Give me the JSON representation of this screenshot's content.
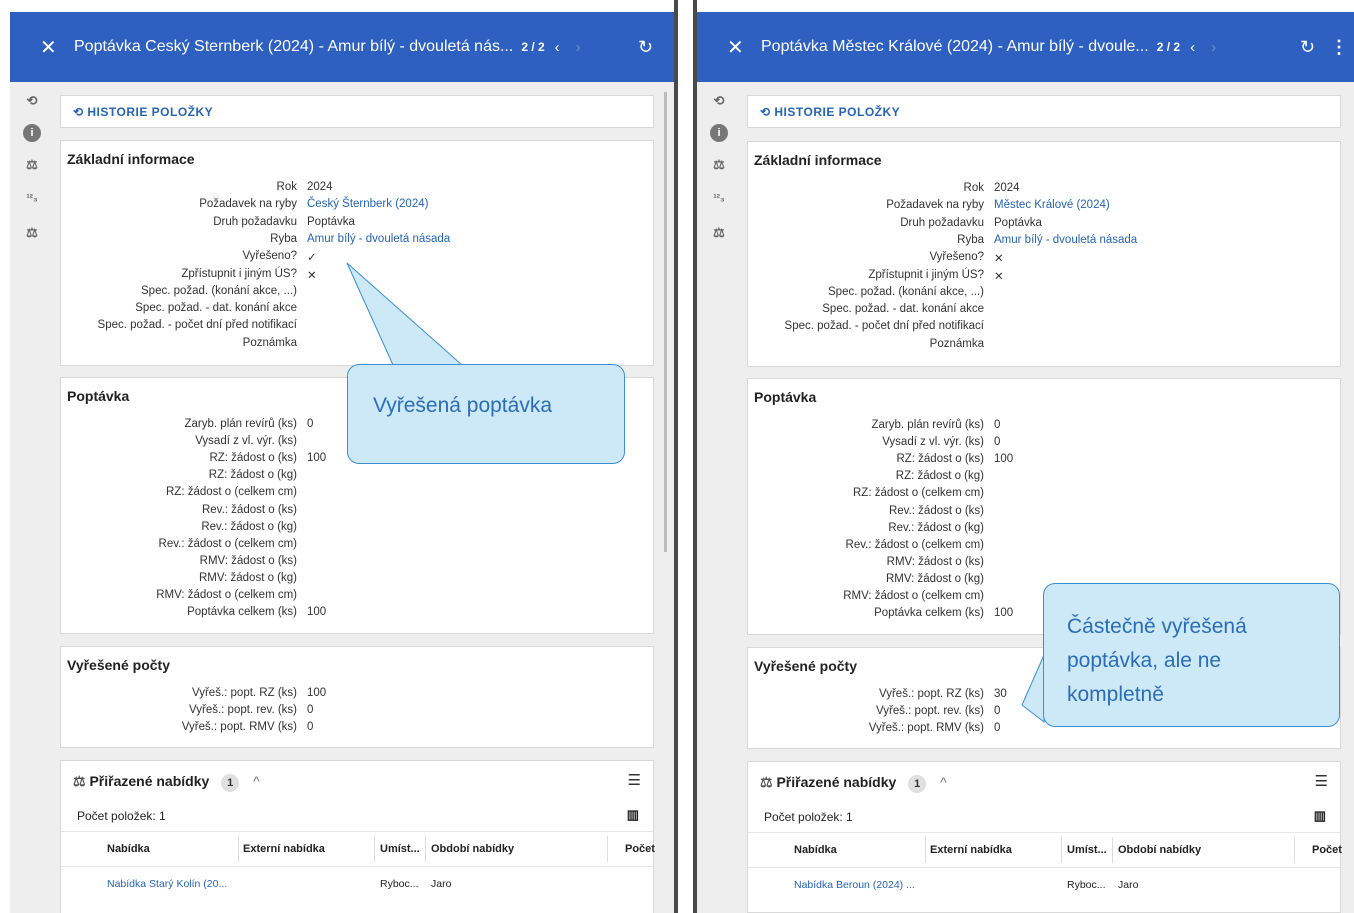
{
  "left": {
    "header": {
      "title": "Poptávka Ceský Sternberk (2024) - Amur bílý - dvouletá nás...",
      "counter": "2 / 2"
    },
    "history_button": "HISTORIE POLOŽKY",
    "zakladni": {
      "title": "Základní informace",
      "rows": [
        {
          "label": "Rok",
          "value": "2024"
        },
        {
          "label": "Požadavek na ryby",
          "value": "Český Šternberk (2024)"
        },
        {
          "label": "Druh požadavku",
          "value": "Poptávka"
        },
        {
          "label": "Ryba",
          "value": "Amur bílý - dvouletá násada"
        },
        {
          "label": "Vyřešeno?",
          "value": "✓"
        },
        {
          "label": "Zpřístupnit i jiným ÚS?",
          "value": "✕"
        },
        {
          "label": "Spec. požad. (konání akce, ...)",
          "value": ""
        },
        {
          "label": "Spec. požad. - dat. konání akce",
          "value": ""
        },
        {
          "label": "Spec. požad. - počet dní před notifikací",
          "value": ""
        },
        {
          "label": "Poznámka",
          "value": ""
        }
      ]
    },
    "poptavka": {
      "title": "Poptávka",
      "rows": [
        {
          "label": "Zaryb. plán revírů (ks)",
          "value": "0"
        },
        {
          "label": "Vysadí z vl. výr. (ks)",
          "value": ""
        },
        {
          "label": "RZ: žádost o (ks)",
          "value": "100"
        },
        {
          "label": "RZ: žádost o (kg)",
          "value": ""
        },
        {
          "label": "RZ: žádost o (celkem cm)",
          "value": ""
        },
        {
          "label": "Rev.: žádost o (ks)",
          "value": ""
        },
        {
          "label": "Rev.: žádost o (kg)",
          "value": ""
        },
        {
          "label": "Rev.: žádost o (celkem cm)",
          "value": ""
        },
        {
          "label": "RMV: žádost o (ks)",
          "value": ""
        },
        {
          "label": "RMV: žádost o (kg)",
          "value": ""
        },
        {
          "label": "RMV: žádost o (celkem cm)",
          "value": ""
        },
        {
          "label": "Poptávka celkem (ks)",
          "value": "100"
        }
      ]
    },
    "vyresene": {
      "title": "Vyřešené počty",
      "rows": [
        {
          "label": "Vyřeš.: popt. RZ (ks)",
          "value": "100"
        },
        {
          "label": "Vyřeš.: popt. rev. (ks)",
          "value": "0"
        },
        {
          "label": "Vyřeš.: popt. RMV (ks)",
          "value": "0"
        }
      ]
    },
    "nabidky": {
      "title": "Přiřazené nabídky",
      "badge": "1",
      "count_text": "Počet položek: 1",
      "columns": [
        "Nabídka",
        "Externí nabídka",
        "Umíst...",
        "Období nabídky",
        "Počet"
      ],
      "row": [
        "Nabídka Starý Kolín (20...",
        "",
        "Ryboc...",
        "Jaro"
      ]
    },
    "callout": "Vyřešená poptávka"
  },
  "right": {
    "header": {
      "title": "Poptávka Městec Králové (2024) - Amur bílý - dvoule...",
      "counter": "2 / 2"
    },
    "history_button": "HISTORIE POLOŽKY",
    "zakladni": {
      "title": "Základní informace",
      "rows": [
        {
          "label": "Rok",
          "value": "2024"
        },
        {
          "label": "Požadavek na ryby",
          "value": "Městec Králové (2024)"
        },
        {
          "label": "Druh požadavku",
          "value": "Poptávka"
        },
        {
          "label": "Ryba",
          "value": "Amur bílý - dvouletá násada"
        },
        {
          "label": "Vyřešeno?",
          "value": "✕"
        },
        {
          "label": "Zpřístupnit i jiným ÚS?",
          "value": "✕"
        },
        {
          "label": "Spec. požad. (konání akce, ...)",
          "value": ""
        },
        {
          "label": "Spec. požad. - dat. konání akce",
          "value": ""
        },
        {
          "label": "Spec. požad. - počet dní před notifikací",
          "value": ""
        },
        {
          "label": "Poznámka",
          "value": ""
        }
      ]
    },
    "poptavka": {
      "title": "Poptávka",
      "rows": [
        {
          "label": "Zaryb. plán revírů (ks)",
          "value": "0"
        },
        {
          "label": "Vysadí z vl. výr. (ks)",
          "value": "0"
        },
        {
          "label": "RZ: žádost o (ks)",
          "value": "100"
        },
        {
          "label": "RZ: žádost o (kg)",
          "value": ""
        },
        {
          "label": "RZ: žádost o (celkem cm)",
          "value": ""
        },
        {
          "label": "Rev.: žádost o (ks)",
          "value": ""
        },
        {
          "label": "Rev.: žádost o (kg)",
          "value": ""
        },
        {
          "label": "Rev.: žádost o (celkem cm)",
          "value": ""
        },
        {
          "label": "RMV: žádost o (ks)",
          "value": ""
        },
        {
          "label": "RMV: žádost o (kg)",
          "value": ""
        },
        {
          "label": "RMV: žádost o (celkem cm)",
          "value": ""
        },
        {
          "label": "Poptávka celkem (ks)",
          "value": "100"
        }
      ]
    },
    "vyresene": {
      "title": "Vyřešené počty",
      "rows": [
        {
          "label": "Vyřeš.: popt. RZ (ks)",
          "value": "30"
        },
        {
          "label": "Vyřeš.: popt. rev. (ks)",
          "value": "0"
        },
        {
          "label": "Vyřeš.: popt. RMV (ks)",
          "value": "0"
        }
      ]
    },
    "nabidky": {
      "title": "Přiřazené nabídky",
      "badge": "1",
      "count_text": "Počet položek: 1",
      "columns": [
        "Nabídka",
        "Externí nabídka",
        "Umíst...",
        "Období nabídky",
        "Počet"
      ],
      "row": [
        "Nabídka Beroun (2024) ...",
        "",
        "Ryboc...",
        "Jaro"
      ]
    },
    "callout": [
      "Částečně vyřešená",
      "poptávka, ale ne",
      "kompletně"
    ]
  },
  "icons": {
    "close": "close-icon",
    "refresh": "refresh-icon",
    "kebab": "more-vert-icon",
    "history": "history-icon",
    "info": "info-icon",
    "scales": "scales-icon",
    "numbers": "numbers-icon",
    "list": "list-icon",
    "columns": "columns-icon"
  },
  "colors": {
    "header": "#2d60c0",
    "link": "#2664b5",
    "callout_fill": "#cde9f7",
    "callout_border": "#3b8fd2"
  }
}
